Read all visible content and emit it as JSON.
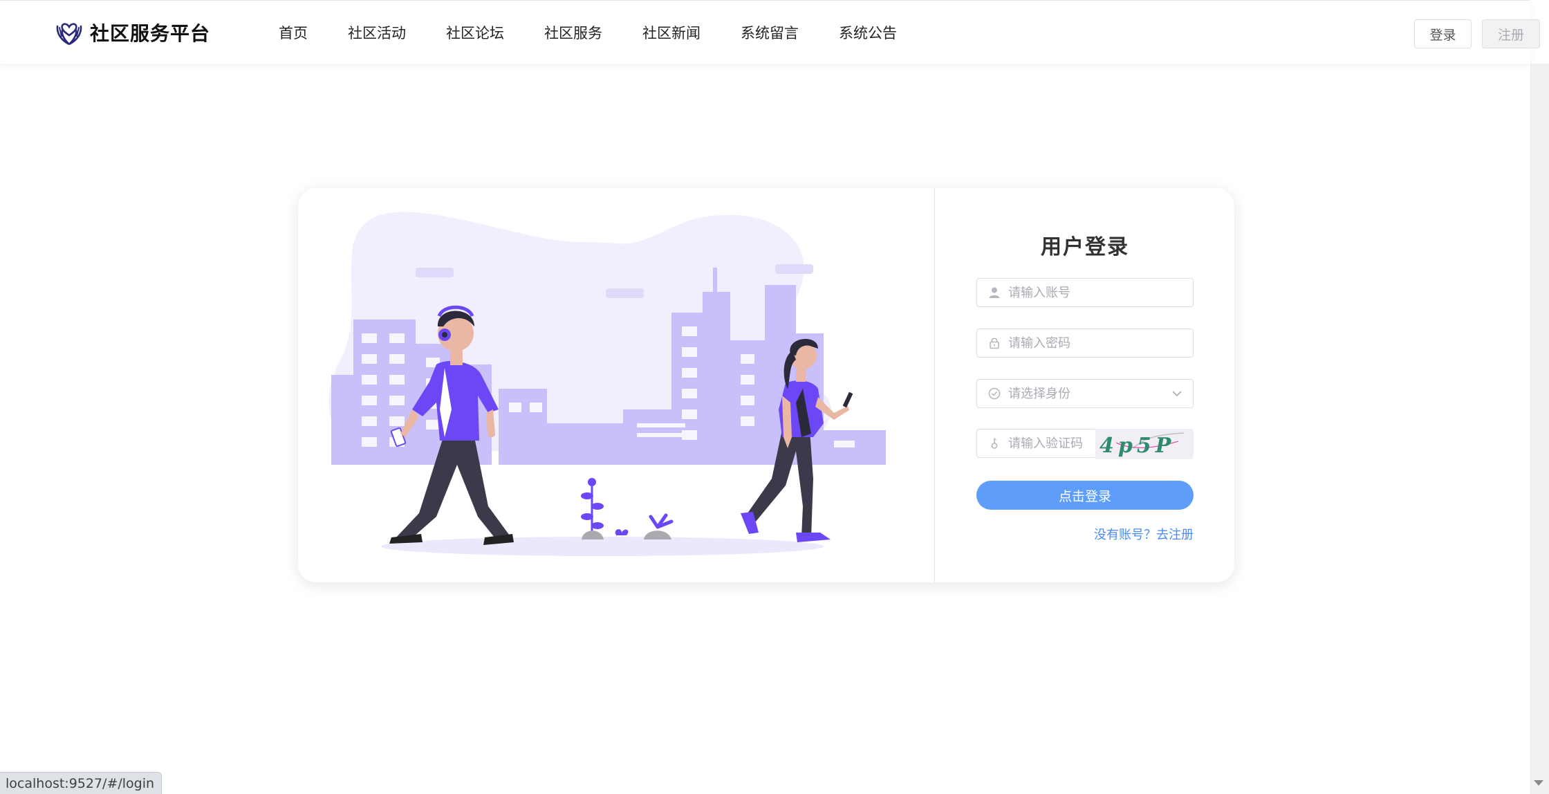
{
  "brand": {
    "name": "社区服务平台",
    "icon": "heart-hands-icon",
    "icon_color": "#2b2a7a"
  },
  "nav": {
    "items": [
      "首页",
      "社区活动",
      "社区论坛",
      "社区服务",
      "社区新闻",
      "系统留言",
      "系统公告"
    ]
  },
  "header": {
    "login_label": "登录",
    "register_label": "注册"
  },
  "login": {
    "title": "用户登录",
    "account_placeholder": "请输入账号",
    "password_placeholder": "请输入密码",
    "role_placeholder": "请选择身份",
    "captcha_placeholder": "请输入验证码",
    "captcha_text": "4p5P",
    "submit_label": "点击登录",
    "register_link": "没有账号？去注册",
    "accent_color": "#5e9dfa",
    "link_color": "#4a8cf7"
  },
  "illustration": {
    "primary_color": "#6c47f5",
    "city_color": "#c9bffb",
    "blob_color": "#f1eefd"
  },
  "status_bar": {
    "url": "localhost:9527/#/login"
  }
}
